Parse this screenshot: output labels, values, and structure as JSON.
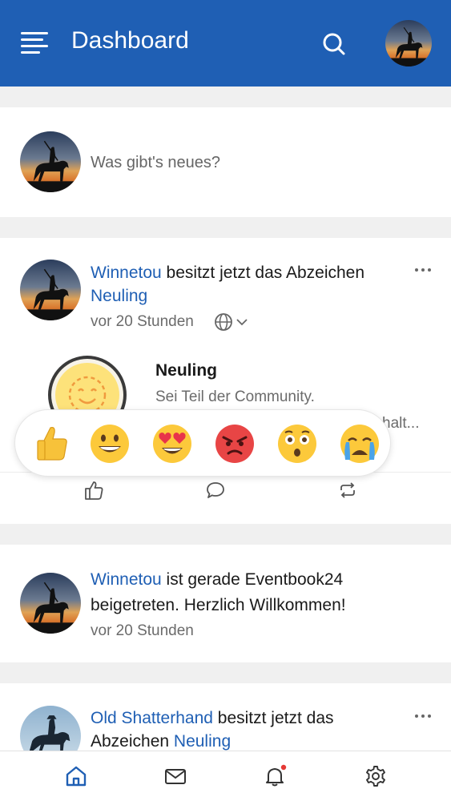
{
  "appbar": {
    "title": "Dashboard"
  },
  "composer": {
    "placeholder": "Was gibt's neues?"
  },
  "posts": [
    {
      "user": "Winnetou",
      "text": " besitzt jetzt das Abzeichen ",
      "badge_link": "Neuling",
      "time": "vor 20 Stunden",
      "badge": {
        "title": "Neuling",
        "description": "Sei Teil der Community.",
        "more": "halt..."
      }
    },
    {
      "user": "Winnetou",
      "text": " ist gerade Eventbook24 beigetreten. Herzlich Willkommen!",
      "time": "vor 20 Stunden"
    },
    {
      "user": "Old Shatterhand",
      "text": " besitzt jetzt das Abzeichen ",
      "badge_link": "Neuling"
    }
  ],
  "reactions": [
    "thumbs-up",
    "grinning",
    "heart-eyes",
    "angry",
    "astonished",
    "crying"
  ],
  "colors": {
    "primary": "#1f5fb4",
    "notification_dot": "#e53935"
  }
}
